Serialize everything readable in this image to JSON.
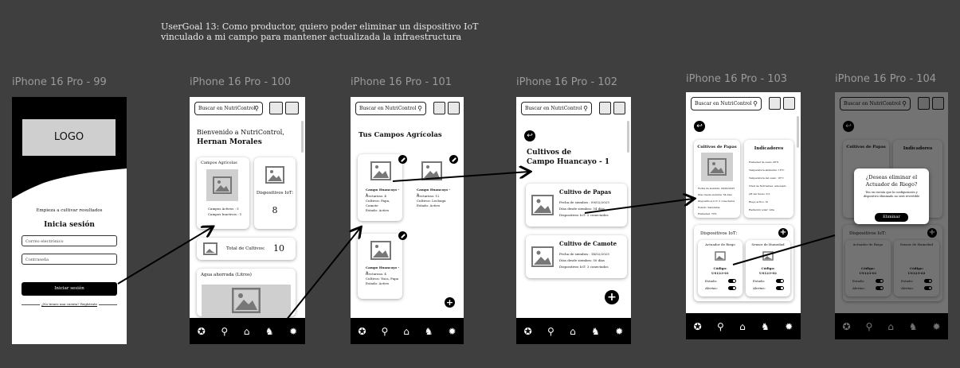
{
  "user_story": "UserGoal 13: Como productor, quiero poder eliminar un dispositivo IoT vinculado a mi campo para mantener actualizada la infraestructura",
  "frame_labels": [
    "iPhone 16 Pro - 99",
    "iPhone 16 Pro - 100",
    "iPhone 16 Pro - 101",
    "iPhone 16 Pro - 102",
    "iPhone 16 Pro - 103",
    "iPhone 16 Pro - 104"
  ],
  "search_placeholder": "Buscar en NutriControl",
  "nav_icons": [
    "star-icon",
    "search-icon",
    "home-icon",
    "farmer-icon",
    "bulb-icon"
  ],
  "login": {
    "logo": "LOGO",
    "tagline": "Empieza a cultivar resultados",
    "title": "Inicia sesión",
    "email_placeholder": "Correo electrónico",
    "password_placeholder": "Contraseña",
    "submit": "Iniciar sesión",
    "register": "¿No tienes una cuenta? Regístrate"
  },
  "home": {
    "greeting": "Bienvenido a NutriControl,",
    "user": "Hernan Morales",
    "campos_title": "Campos Agrícolas",
    "activos": "Campos Activos : 5",
    "inactivos": "Campos Inactivos : 1",
    "dispositivos": "Dispositivos IoT:",
    "dispositivos_count": "8",
    "total_cultivos": "Total de Cultivos:",
    "total_cultivos_count": "10",
    "agua": "Agua ahorrada (Litros)"
  },
  "campos": {
    "title": "Tus Campos Agrícolas",
    "items": [
      {
        "name": "Campo Huancayo - 1",
        "l1": "Hectareas: 4",
        "l2": "Cultivos: Papa, Camote",
        "l3": "Estado: Activo"
      },
      {
        "name": "Campo Huancayo - 2",
        "l1": "Hectareas: 12",
        "l2": "Cultivos: Lechuga",
        "l3": "Estado: Activo"
      },
      {
        "name": "Campo Huancayo - 3",
        "l1": "Hectareas: 4",
        "l2": "Cultivos: Yuca, Papa",
        "l3": "Estado: Activo"
      }
    ]
  },
  "cultivos": {
    "title1": "Cultivos de",
    "title2": "Campo Huancayo - 1",
    "items": [
      {
        "name": "Cultivo de Papas",
        "l1": "Fecha de siembra : 09/02/2025",
        "l2": "Días desde siembra: 54 días",
        "l3": "Dispositivos IoT: 2 conectados"
      },
      {
        "name": "Cultivo de Camote",
        "l1": "Fecha de siembra : 14/02/2025",
        "l2": "Días desde siembra: 50 días",
        "l3": "Dispositivos IoT: 3 conectados"
      }
    ]
  },
  "detalle": {
    "cultivo": "Cultivos de Papas",
    "indicadores": "Indicadores",
    "info": [
      "Fecha de siembra: 09/02/2025",
      "Días desde siembra: 54 días",
      "Dispositivos IoT: 2 conectados",
      "Estado: Saludable",
      "Humedad: 70%"
    ],
    "ind": [
      "Humedad de suelo: 68%",
      "Temperatura ambiente: 18°C",
      "Temperatura del suelo: 16°C",
      "Nivel de Nutrientes: Adecuado",
      "pH del Suelo: 6.5",
      "Riego activo: Sí",
      "Radiación solar: Alta"
    ],
    "dispositivos": "Dispositivos IoT:",
    "devices": [
      {
        "name": "Actuador de Riego",
        "code_label": "Código:",
        "code": "US123-01",
        "estado": "Estado:",
        "alertas": "Alertas:"
      },
      {
        "name": "Sensor de Humedad",
        "code_label": "Código:",
        "code": "US123-02",
        "estado": "Estado:",
        "alertas": "Alertas:"
      }
    ]
  },
  "dialog": {
    "title": "¿Deseas eliminar el Actuador de Riego?",
    "body": "Ten en cuenta que la configuración y dispositivo eliminado no será revertible",
    "button": "Eliminar"
  },
  "accent": "#000000",
  "background": "#3f3f3f"
}
